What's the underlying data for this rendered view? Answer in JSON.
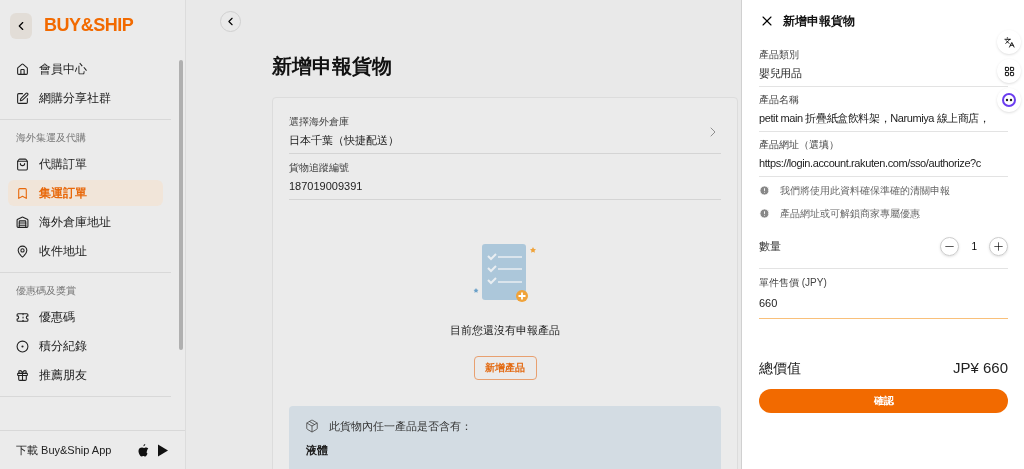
{
  "sidebar": {
    "logo": "BUY&SHIP",
    "groups": [
      {
        "items": [
          {
            "label": "會員中心",
            "selected": false
          },
          {
            "label": "網購分享社群",
            "selected": false
          }
        ]
      },
      {
        "heading": "海外集運及代購",
        "items": [
          {
            "label": "代購訂單",
            "selected": false
          },
          {
            "label": "集運訂單",
            "selected": true
          },
          {
            "label": "海外倉庫地址",
            "selected": false
          },
          {
            "label": "收件地址",
            "selected": false
          }
        ]
      },
      {
        "heading": "優惠碼及獎賞",
        "items": [
          {
            "label": "優惠碼",
            "selected": false
          },
          {
            "label": "積分紀錄",
            "selected": false
          },
          {
            "label": "推薦朋友",
            "selected": false
          }
        ]
      }
    ],
    "download": "下載 Buy&Ship App"
  },
  "main": {
    "title": "新增申報貨物",
    "fields": [
      {
        "label": "選擇海外倉庫",
        "value": "日本千葉（快捷配送）",
        "kind": "select"
      },
      {
        "label": "貨物追蹤編號",
        "value": "187019009391",
        "kind": "text"
      }
    ],
    "empty_message": "目前您還沒有申報產品",
    "add_button": "新增產品",
    "notice": {
      "title": "此貨物內任一產品是否含有：",
      "item": "液體"
    }
  },
  "drawer": {
    "title": "新增申報貨物",
    "fields": [
      {
        "label": "產品類別",
        "value": "嬰兒用品"
      },
      {
        "label": "產品名稱",
        "value": "petit main 折疊紙盒飲料架，Narumiya 線上商店，"
      },
      {
        "label": "產品網址（選填）",
        "value": "https://login.account.rakuten.com/sso/authorize?c"
      }
    ],
    "hints": [
      "我們將使用此資料確保準確的清關申報",
      "產品網址或可解鎖商家專屬優惠"
    ],
    "quantity": {
      "label": "數量",
      "value": "1"
    },
    "price": {
      "label": "單件售價 (JPY)",
      "value": "660",
      "focused": true
    },
    "total": {
      "label": "總價值",
      "value": "JP¥ 660"
    },
    "confirm": "確認"
  }
}
